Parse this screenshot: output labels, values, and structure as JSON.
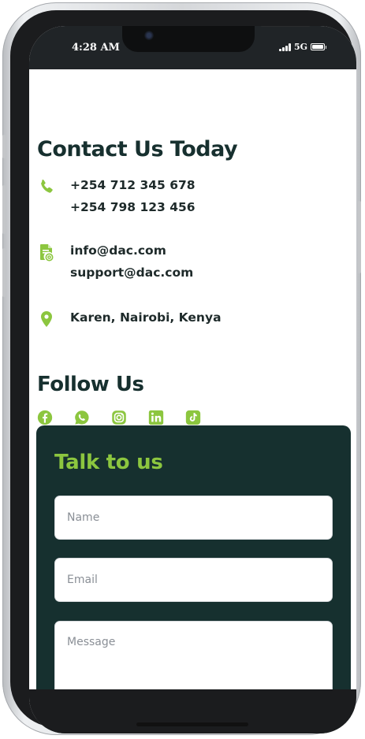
{
  "status_bar": {
    "time": "4:28 AM",
    "network": "5G"
  },
  "contact": {
    "title": "Contact Us Today",
    "phones": [
      "+254 712 345 678",
      "+254 798 123 456"
    ],
    "emails": [
      "info@dac.com",
      "support@dac.com"
    ],
    "location": "Karen, Nairobi, Kenya"
  },
  "follow": {
    "title": "Follow Us",
    "icons": [
      "facebook-icon",
      "whatsapp-icon",
      "instagram-icon",
      "linkedin-icon",
      "tiktok-icon"
    ]
  },
  "form": {
    "title": "Talk to us",
    "name_placeholder": "Name",
    "email_placeholder": "Email",
    "message_placeholder": "Message"
  },
  "colors": {
    "accent": "#8cc63f",
    "dark_green": "#16302f",
    "heading": "#17302f",
    "status_bar": "#202427"
  }
}
